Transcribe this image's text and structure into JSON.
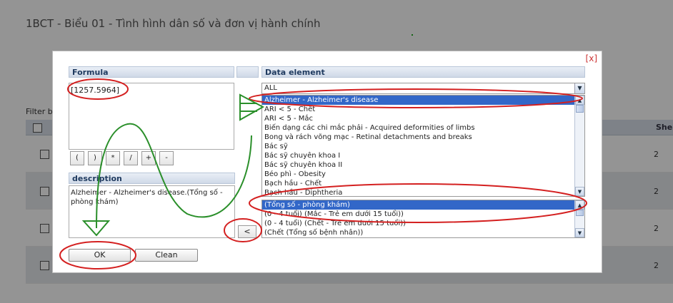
{
  "background": {
    "page_title": "1BCT - Biểu 01 - Tình hình dân số và đơn vị hành chính",
    "filter_label": "Filter by",
    "header_col": "She",
    "rows": [
      {
        "value": "2"
      },
      {
        "value": "2"
      },
      {
        "value": "2"
      },
      {
        "value": "2"
      }
    ]
  },
  "dialog": {
    "close_label": "[x]",
    "formula": {
      "header": "Formula",
      "value": "[1257.5964]",
      "operators": [
        "(",
        ")",
        "*",
        "/",
        "+",
        "-"
      ]
    },
    "description": {
      "header": "description",
      "value": "Alzheimer - Alzheimer's disease.(Tổng số - phòng khám)"
    },
    "arrow_button": "<",
    "ok_button": "OK",
    "clean_button": "Clean",
    "data_element": {
      "header": "Data element",
      "filter_selected": "ALL",
      "elements": [
        "Alzheimer - Alzheimer's disease",
        "ARI < 5 - Chết",
        "ARI < 5 - Mắc",
        "Biến dạng các chi mắc phải - Acquired deformities of limbs",
        "Bong và rách võng mạc - Retinal detachments and breaks",
        "Bác sỹ",
        "Bác sỹ chuyên khoa I",
        "Bác sỹ chuyên khoa II",
        "Béo phì - Obesity",
        "Bạch hầu - Chết",
        "Bạch hầu - Diphtheria"
      ],
      "selected_element_index": 0,
      "category_options": [
        "(Tổng số - phòng khám)",
        "(0 - 4 tuổi) (Mắc - Trẻ em dưới 15 tuổi))",
        "(0 - 4 tuổi) (Chết - Trẻ em dưới 15 tuổi))",
        "(Chết (Tổng số bệnh nhân))"
      ],
      "selected_category_index": 0
    }
  },
  "colors": {
    "annotation_red": "#d42020",
    "annotation_green": "#2a8f2a",
    "selection_blue": "#3267c8"
  }
}
